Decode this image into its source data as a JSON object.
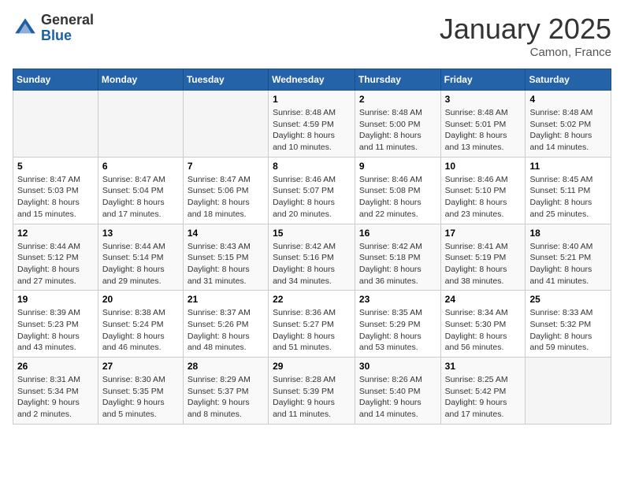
{
  "header": {
    "logo_general": "General",
    "logo_blue": "Blue",
    "month_title": "January 2025",
    "location": "Camon, France"
  },
  "days_of_week": [
    "Sunday",
    "Monday",
    "Tuesday",
    "Wednesday",
    "Thursday",
    "Friday",
    "Saturday"
  ],
  "weeks": [
    {
      "days": [
        {
          "number": "",
          "info": ""
        },
        {
          "number": "",
          "info": ""
        },
        {
          "number": "",
          "info": ""
        },
        {
          "number": "1",
          "info": "Sunrise: 8:48 AM\nSunset: 4:59 PM\nDaylight: 8 hours\nand 10 minutes."
        },
        {
          "number": "2",
          "info": "Sunrise: 8:48 AM\nSunset: 5:00 PM\nDaylight: 8 hours\nand 11 minutes."
        },
        {
          "number": "3",
          "info": "Sunrise: 8:48 AM\nSunset: 5:01 PM\nDaylight: 8 hours\nand 13 minutes."
        },
        {
          "number": "4",
          "info": "Sunrise: 8:48 AM\nSunset: 5:02 PM\nDaylight: 8 hours\nand 14 minutes."
        }
      ]
    },
    {
      "days": [
        {
          "number": "5",
          "info": "Sunrise: 8:47 AM\nSunset: 5:03 PM\nDaylight: 8 hours\nand 15 minutes."
        },
        {
          "number": "6",
          "info": "Sunrise: 8:47 AM\nSunset: 5:04 PM\nDaylight: 8 hours\nand 17 minutes."
        },
        {
          "number": "7",
          "info": "Sunrise: 8:47 AM\nSunset: 5:06 PM\nDaylight: 8 hours\nand 18 minutes."
        },
        {
          "number": "8",
          "info": "Sunrise: 8:46 AM\nSunset: 5:07 PM\nDaylight: 8 hours\nand 20 minutes."
        },
        {
          "number": "9",
          "info": "Sunrise: 8:46 AM\nSunset: 5:08 PM\nDaylight: 8 hours\nand 22 minutes."
        },
        {
          "number": "10",
          "info": "Sunrise: 8:46 AM\nSunset: 5:10 PM\nDaylight: 8 hours\nand 23 minutes."
        },
        {
          "number": "11",
          "info": "Sunrise: 8:45 AM\nSunset: 5:11 PM\nDaylight: 8 hours\nand 25 minutes."
        }
      ]
    },
    {
      "days": [
        {
          "number": "12",
          "info": "Sunrise: 8:44 AM\nSunset: 5:12 PM\nDaylight: 8 hours\nand 27 minutes."
        },
        {
          "number": "13",
          "info": "Sunrise: 8:44 AM\nSunset: 5:14 PM\nDaylight: 8 hours\nand 29 minutes."
        },
        {
          "number": "14",
          "info": "Sunrise: 8:43 AM\nSunset: 5:15 PM\nDaylight: 8 hours\nand 31 minutes."
        },
        {
          "number": "15",
          "info": "Sunrise: 8:42 AM\nSunset: 5:16 PM\nDaylight: 8 hours\nand 34 minutes."
        },
        {
          "number": "16",
          "info": "Sunrise: 8:42 AM\nSunset: 5:18 PM\nDaylight: 8 hours\nand 36 minutes."
        },
        {
          "number": "17",
          "info": "Sunrise: 8:41 AM\nSunset: 5:19 PM\nDaylight: 8 hours\nand 38 minutes."
        },
        {
          "number": "18",
          "info": "Sunrise: 8:40 AM\nSunset: 5:21 PM\nDaylight: 8 hours\nand 41 minutes."
        }
      ]
    },
    {
      "days": [
        {
          "number": "19",
          "info": "Sunrise: 8:39 AM\nSunset: 5:23 PM\nDaylight: 8 hours\nand 43 minutes."
        },
        {
          "number": "20",
          "info": "Sunrise: 8:38 AM\nSunset: 5:24 PM\nDaylight: 8 hours\nand 46 minutes."
        },
        {
          "number": "21",
          "info": "Sunrise: 8:37 AM\nSunset: 5:26 PM\nDaylight: 8 hours\nand 48 minutes."
        },
        {
          "number": "22",
          "info": "Sunrise: 8:36 AM\nSunset: 5:27 PM\nDaylight: 8 hours\nand 51 minutes."
        },
        {
          "number": "23",
          "info": "Sunrise: 8:35 AM\nSunset: 5:29 PM\nDaylight: 8 hours\nand 53 minutes."
        },
        {
          "number": "24",
          "info": "Sunrise: 8:34 AM\nSunset: 5:30 PM\nDaylight: 8 hours\nand 56 minutes."
        },
        {
          "number": "25",
          "info": "Sunrise: 8:33 AM\nSunset: 5:32 PM\nDaylight: 8 hours\nand 59 minutes."
        }
      ]
    },
    {
      "days": [
        {
          "number": "26",
          "info": "Sunrise: 8:31 AM\nSunset: 5:34 PM\nDaylight: 9 hours\nand 2 minutes."
        },
        {
          "number": "27",
          "info": "Sunrise: 8:30 AM\nSunset: 5:35 PM\nDaylight: 9 hours\nand 5 minutes."
        },
        {
          "number": "28",
          "info": "Sunrise: 8:29 AM\nSunset: 5:37 PM\nDaylight: 9 hours\nand 8 minutes."
        },
        {
          "number": "29",
          "info": "Sunrise: 8:28 AM\nSunset: 5:39 PM\nDaylight: 9 hours\nand 11 minutes."
        },
        {
          "number": "30",
          "info": "Sunrise: 8:26 AM\nSunset: 5:40 PM\nDaylight: 9 hours\nand 14 minutes."
        },
        {
          "number": "31",
          "info": "Sunrise: 8:25 AM\nSunset: 5:42 PM\nDaylight: 9 hours\nand 17 minutes."
        },
        {
          "number": "",
          "info": ""
        }
      ]
    }
  ]
}
